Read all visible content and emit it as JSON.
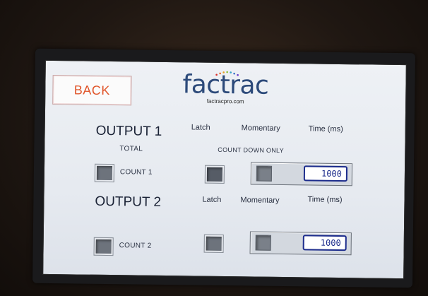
{
  "back_button": {
    "label": "BACK"
  },
  "logo": {
    "text": "factrac",
    "url": "factracpro.com"
  },
  "output1": {
    "title": "OUTPUT 1",
    "latch_label": "Latch",
    "momentary_label": "Momentary",
    "time_label": "Time (ms)",
    "total_label": "TOTAL",
    "count_down_label": "COUNT DOWN ONLY",
    "count_label": "COUNT 1",
    "time_value": "1000"
  },
  "output2": {
    "title": "OUTPUT 2",
    "latch_label": "Latch",
    "momentary_label": "Momentary",
    "time_label": "Time (ms)",
    "count_label": "COUNT 2",
    "time_value": "1000"
  },
  "colors": {
    "back_text": "#e0552a",
    "logo_text": "#2c4a7a",
    "input_border": "#1c2c8c",
    "checkbox_fill": "#6d737c"
  }
}
